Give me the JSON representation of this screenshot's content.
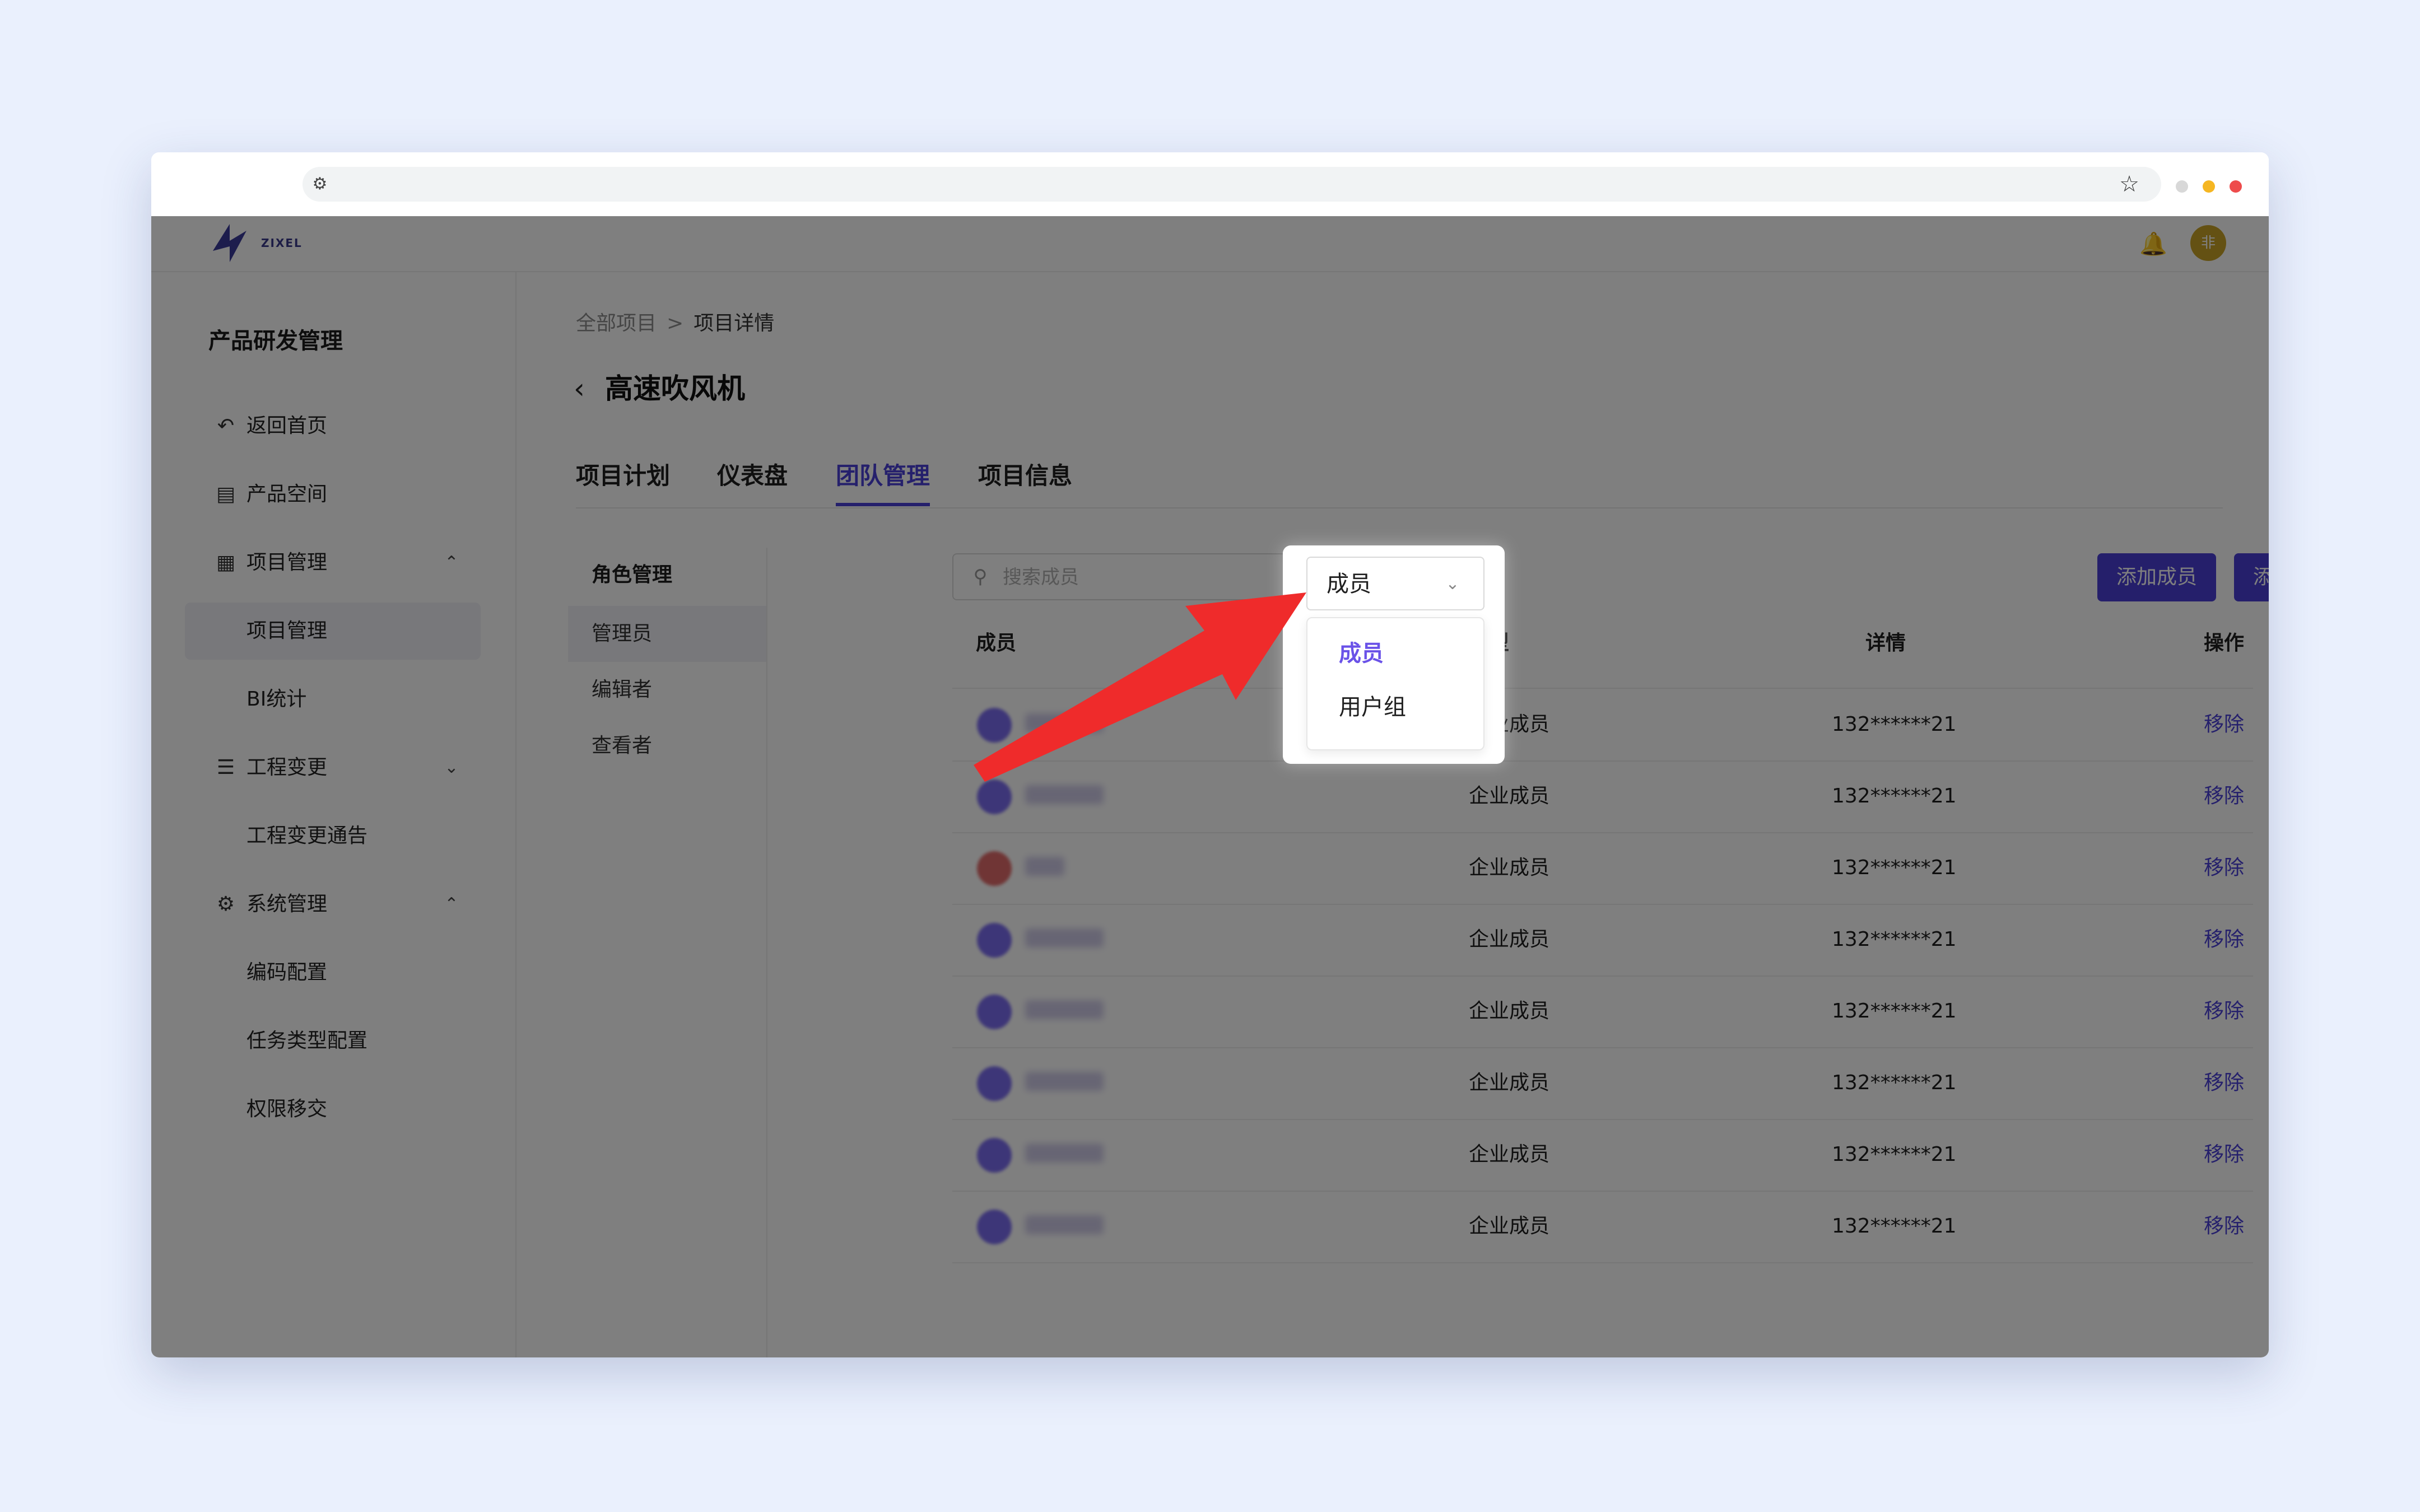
{
  "app": {
    "logo_text": "ZIXEL",
    "avatar_text": "非"
  },
  "sidebar": {
    "title": "产品研发管理",
    "items": [
      {
        "label": "返回首页"
      },
      {
        "label": "产品空间"
      },
      {
        "label": "项目管理"
      },
      {
        "label": "项目管理"
      },
      {
        "label": "BI统计"
      },
      {
        "label": "工程变更"
      },
      {
        "label": "工程变更通告"
      },
      {
        "label": "系统管理"
      },
      {
        "label": "编码配置"
      },
      {
        "label": "任务类型配置"
      },
      {
        "label": "权限移交"
      }
    ]
  },
  "breadcrumb": {
    "root": "全部项目",
    "separator": ">",
    "current": "项目详情"
  },
  "page": {
    "title": "高速吹风机"
  },
  "tabs": [
    {
      "label": "项目计划"
    },
    {
      "label": "仪表盘"
    },
    {
      "label": "团队管理",
      "active": true
    },
    {
      "label": "项目信息"
    }
  ],
  "roles": {
    "header": "角色管理",
    "items": [
      {
        "label": "管理员",
        "active": true
      },
      {
        "label": "编辑者"
      },
      {
        "label": "查看者"
      }
    ]
  },
  "search": {
    "placeholder": "搜索成员",
    "value": ""
  },
  "type_select": {
    "value": "成员",
    "options": [
      {
        "label": "成员",
        "selected": true
      },
      {
        "label": "用户组"
      }
    ]
  },
  "actions": {
    "add_member": "添加成员",
    "add_group": "添加用户组"
  },
  "table": {
    "columns": [
      "成员",
      "类型",
      "详情",
      "操作"
    ],
    "rows": [
      {
        "type": "企业成员",
        "detail": "132******21",
        "action": "移除"
      },
      {
        "type": "企业成员",
        "detail": "132******21",
        "action": "移除"
      },
      {
        "type": "企业成员",
        "detail": "132******21",
        "action": "移除"
      },
      {
        "type": "企业成员",
        "detail": "132******21",
        "action": "移除"
      },
      {
        "type": "企业成员",
        "detail": "132******21",
        "action": "移除"
      },
      {
        "type": "企业成员",
        "detail": "132******21",
        "action": "移除"
      },
      {
        "type": "企业成员",
        "detail": "132******21",
        "action": "移除"
      },
      {
        "type": "企业成员",
        "detail": "132******21",
        "action": "移除"
      }
    ]
  },
  "colors": {
    "accent": "#4b40d8",
    "annotation_arrow": "#ef2b2b",
    "background": "#eaf0fd"
  }
}
